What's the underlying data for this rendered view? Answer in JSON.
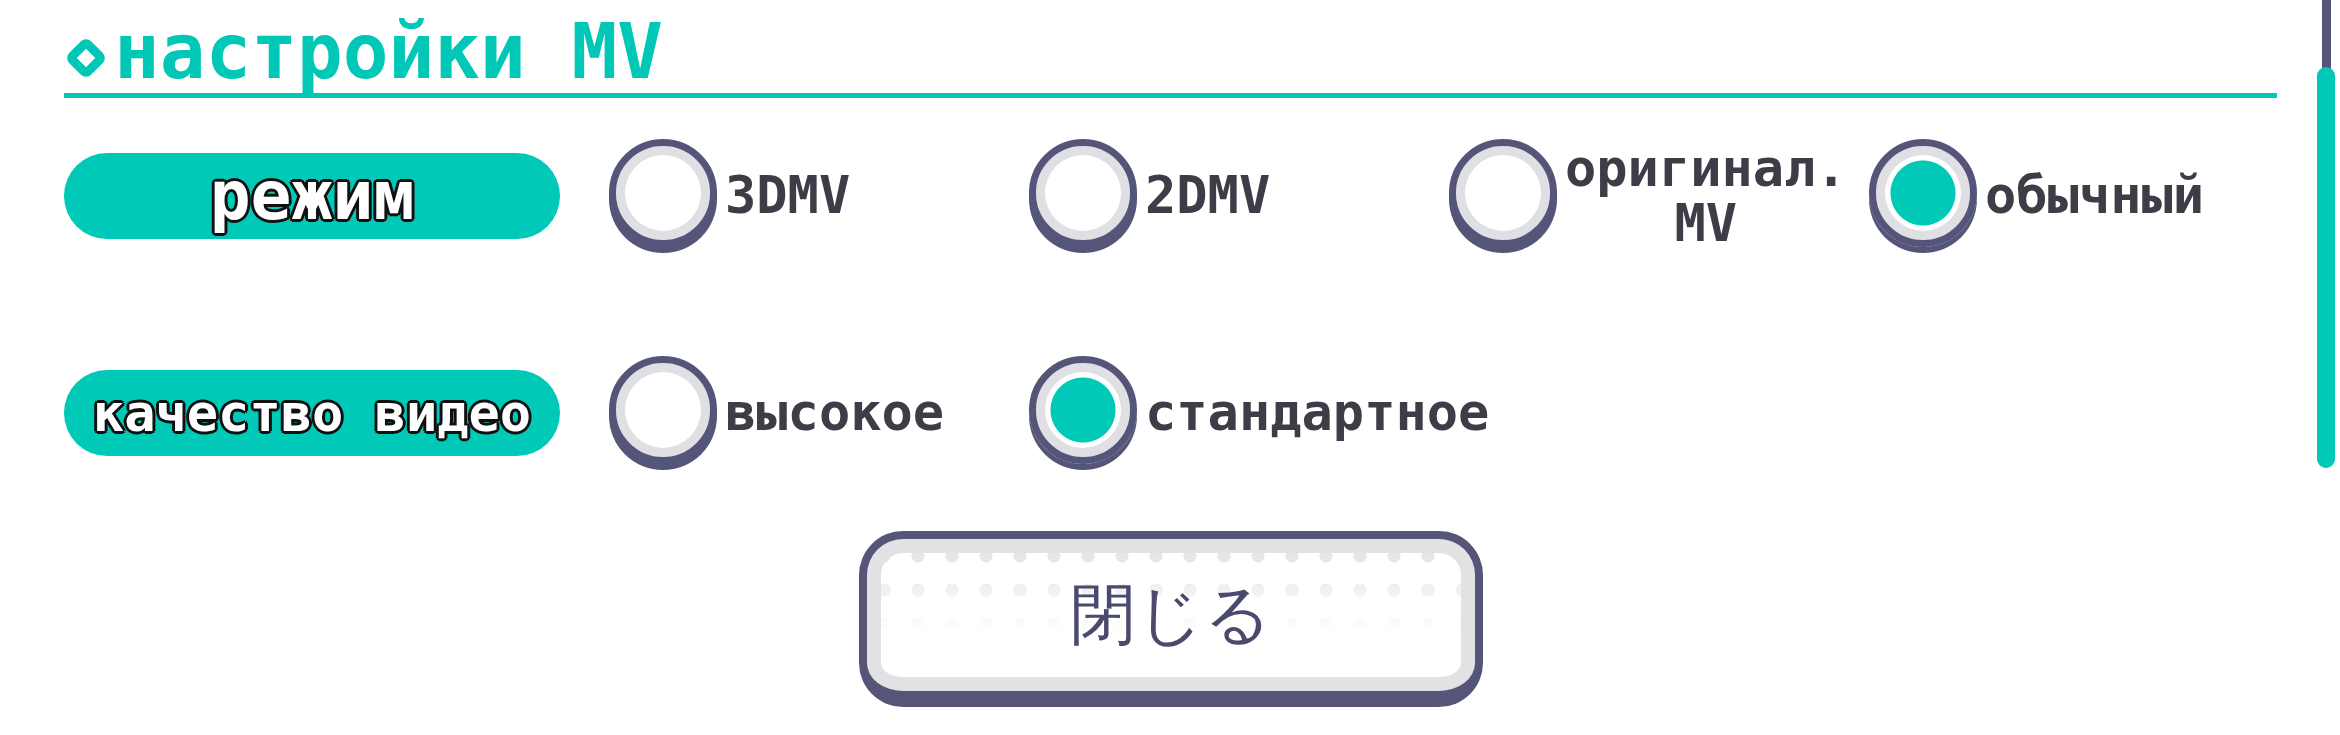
{
  "title": {
    "text": "настройки MV"
  },
  "settings": [
    {
      "label": "режим",
      "options": [
        {
          "label": "3DMV",
          "selected": false
        },
        {
          "label": "2DMV",
          "selected": false
        },
        {
          "label": "оригинал.\nMV",
          "selected": false
        },
        {
          "label": "обычный",
          "selected": true
        }
      ]
    },
    {
      "label": "качество видео",
      "options": [
        {
          "label": "высокое",
          "selected": false
        },
        {
          "label": "стандартное",
          "selected": true
        }
      ]
    }
  ],
  "close_button": {
    "label": "閉じる"
  }
}
